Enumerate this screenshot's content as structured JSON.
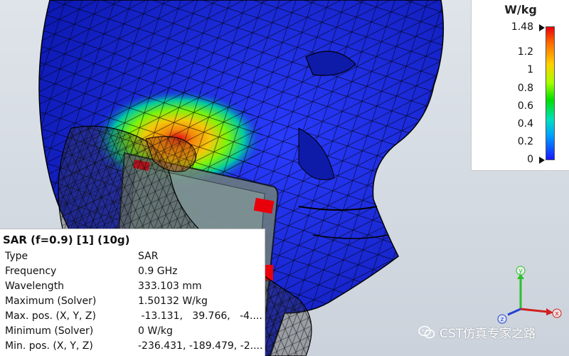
{
  "legend": {
    "unit": "W/kg",
    "ticks": [
      "1.48",
      "1.2",
      "1",
      "0.8",
      "0.6",
      "0.4",
      "0.2",
      "0"
    ],
    "max": 1.48,
    "min": 0
  },
  "info": {
    "title": "SAR (f=0.9) [1] (10g)",
    "rows": [
      {
        "key": "Type",
        "value": "SAR"
      },
      {
        "key": "Frequency",
        "value": "0.9 GHz"
      },
      {
        "key": "Wavelength",
        "value": "333.103 mm"
      },
      {
        "key": "Maximum (Solver)",
        "value": "1.50132 W/kg"
      },
      {
        "key": "Max. pos. (X, Y, Z)",
        "value": " -13.131,   39.766,   -4...."
      },
      {
        "key": "Minimum (Solver)",
        "value": "0 W/kg"
      },
      {
        "key": "Min. pos. (X, Y, Z)",
        "value": "-236.431, -189.479, -2...."
      }
    ]
  },
  "axes": {
    "x": "x",
    "y": "y",
    "z": "z"
  },
  "watermark": {
    "text": "CST仿真专家之路",
    "icon": "wechat-icon"
  },
  "colors": {
    "background_top": "#dfe4ea",
    "background_bottom": "#cbd2db",
    "head_blue": "#1a2be0",
    "hotspot_red": "#e8000b",
    "hotspot_yellow": "#ffd000",
    "hotspot_green": "#00e000"
  }
}
